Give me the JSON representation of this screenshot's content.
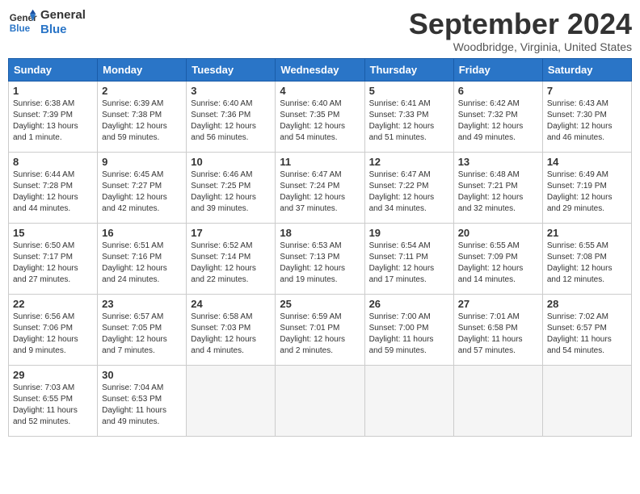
{
  "header": {
    "logo_line1": "General",
    "logo_line2": "Blue",
    "title": "September 2024",
    "location": "Woodbridge, Virginia, United States"
  },
  "days_of_week": [
    "Sunday",
    "Monday",
    "Tuesday",
    "Wednesday",
    "Thursday",
    "Friday",
    "Saturday"
  ],
  "weeks": [
    [
      {
        "day": "1",
        "info": "Sunrise: 6:38 AM\nSunset: 7:39 PM\nDaylight: 13 hours\nand 1 minute."
      },
      {
        "day": "2",
        "info": "Sunrise: 6:39 AM\nSunset: 7:38 PM\nDaylight: 12 hours\nand 59 minutes."
      },
      {
        "day": "3",
        "info": "Sunrise: 6:40 AM\nSunset: 7:36 PM\nDaylight: 12 hours\nand 56 minutes."
      },
      {
        "day": "4",
        "info": "Sunrise: 6:40 AM\nSunset: 7:35 PM\nDaylight: 12 hours\nand 54 minutes."
      },
      {
        "day": "5",
        "info": "Sunrise: 6:41 AM\nSunset: 7:33 PM\nDaylight: 12 hours\nand 51 minutes."
      },
      {
        "day": "6",
        "info": "Sunrise: 6:42 AM\nSunset: 7:32 PM\nDaylight: 12 hours\nand 49 minutes."
      },
      {
        "day": "7",
        "info": "Sunrise: 6:43 AM\nSunset: 7:30 PM\nDaylight: 12 hours\nand 46 minutes."
      }
    ],
    [
      {
        "day": "8",
        "info": "Sunrise: 6:44 AM\nSunset: 7:28 PM\nDaylight: 12 hours\nand 44 minutes."
      },
      {
        "day": "9",
        "info": "Sunrise: 6:45 AM\nSunset: 7:27 PM\nDaylight: 12 hours\nand 42 minutes."
      },
      {
        "day": "10",
        "info": "Sunrise: 6:46 AM\nSunset: 7:25 PM\nDaylight: 12 hours\nand 39 minutes."
      },
      {
        "day": "11",
        "info": "Sunrise: 6:47 AM\nSunset: 7:24 PM\nDaylight: 12 hours\nand 37 minutes."
      },
      {
        "day": "12",
        "info": "Sunrise: 6:47 AM\nSunset: 7:22 PM\nDaylight: 12 hours\nand 34 minutes."
      },
      {
        "day": "13",
        "info": "Sunrise: 6:48 AM\nSunset: 7:21 PM\nDaylight: 12 hours\nand 32 minutes."
      },
      {
        "day": "14",
        "info": "Sunrise: 6:49 AM\nSunset: 7:19 PM\nDaylight: 12 hours\nand 29 minutes."
      }
    ],
    [
      {
        "day": "15",
        "info": "Sunrise: 6:50 AM\nSunset: 7:17 PM\nDaylight: 12 hours\nand 27 minutes."
      },
      {
        "day": "16",
        "info": "Sunrise: 6:51 AM\nSunset: 7:16 PM\nDaylight: 12 hours\nand 24 minutes."
      },
      {
        "day": "17",
        "info": "Sunrise: 6:52 AM\nSunset: 7:14 PM\nDaylight: 12 hours\nand 22 minutes."
      },
      {
        "day": "18",
        "info": "Sunrise: 6:53 AM\nSunset: 7:13 PM\nDaylight: 12 hours\nand 19 minutes."
      },
      {
        "day": "19",
        "info": "Sunrise: 6:54 AM\nSunset: 7:11 PM\nDaylight: 12 hours\nand 17 minutes."
      },
      {
        "day": "20",
        "info": "Sunrise: 6:55 AM\nSunset: 7:09 PM\nDaylight: 12 hours\nand 14 minutes."
      },
      {
        "day": "21",
        "info": "Sunrise: 6:55 AM\nSunset: 7:08 PM\nDaylight: 12 hours\nand 12 minutes."
      }
    ],
    [
      {
        "day": "22",
        "info": "Sunrise: 6:56 AM\nSunset: 7:06 PM\nDaylight: 12 hours\nand 9 minutes."
      },
      {
        "day": "23",
        "info": "Sunrise: 6:57 AM\nSunset: 7:05 PM\nDaylight: 12 hours\nand 7 minutes."
      },
      {
        "day": "24",
        "info": "Sunrise: 6:58 AM\nSunset: 7:03 PM\nDaylight: 12 hours\nand 4 minutes."
      },
      {
        "day": "25",
        "info": "Sunrise: 6:59 AM\nSunset: 7:01 PM\nDaylight: 12 hours\nand 2 minutes."
      },
      {
        "day": "26",
        "info": "Sunrise: 7:00 AM\nSunset: 7:00 PM\nDaylight: 11 hours\nand 59 minutes."
      },
      {
        "day": "27",
        "info": "Sunrise: 7:01 AM\nSunset: 6:58 PM\nDaylight: 11 hours\nand 57 minutes."
      },
      {
        "day": "28",
        "info": "Sunrise: 7:02 AM\nSunset: 6:57 PM\nDaylight: 11 hours\nand 54 minutes."
      }
    ],
    [
      {
        "day": "29",
        "info": "Sunrise: 7:03 AM\nSunset: 6:55 PM\nDaylight: 11 hours\nand 52 minutes."
      },
      {
        "day": "30",
        "info": "Sunrise: 7:04 AM\nSunset: 6:53 PM\nDaylight: 11 hours\nand 49 minutes."
      },
      {
        "day": "",
        "info": ""
      },
      {
        "day": "",
        "info": ""
      },
      {
        "day": "",
        "info": ""
      },
      {
        "day": "",
        "info": ""
      },
      {
        "day": "",
        "info": ""
      }
    ]
  ]
}
